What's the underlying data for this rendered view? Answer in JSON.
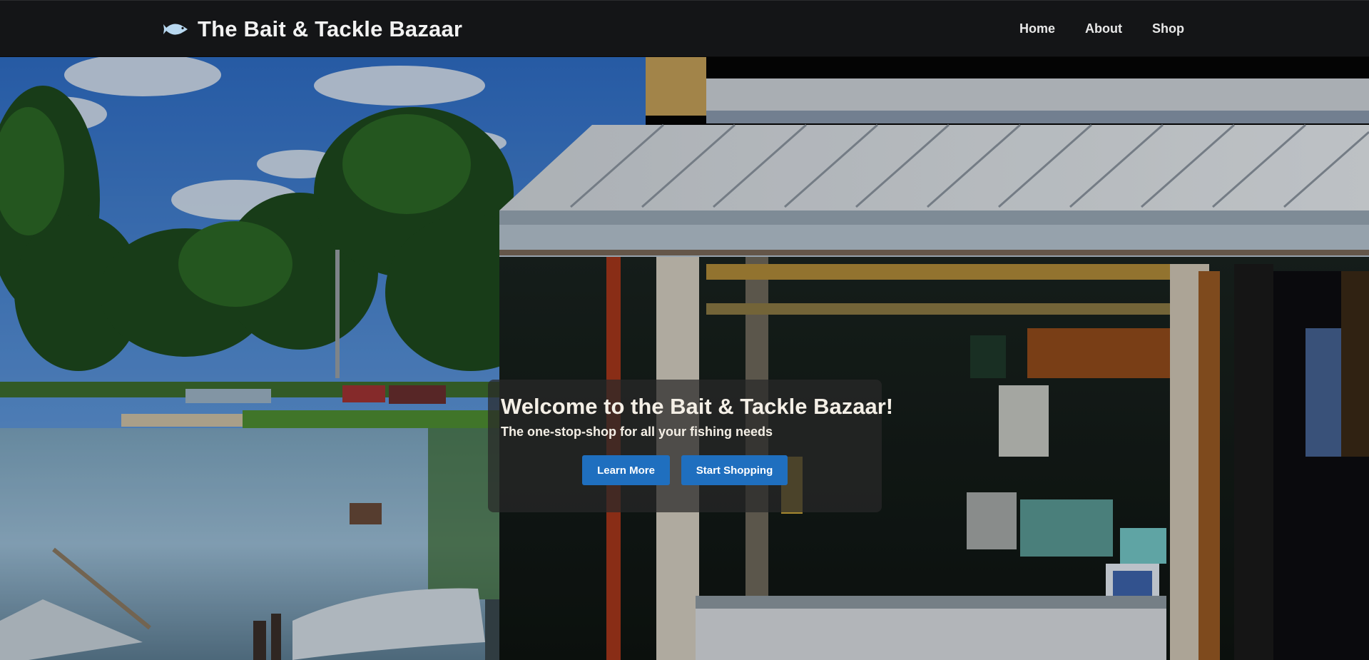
{
  "navbar": {
    "brand_name": "The Bait & Tackle Bazaar",
    "brand_icon": "fish-icon",
    "links": [
      {
        "label": "Home"
      },
      {
        "label": "About"
      },
      {
        "label": "Shop"
      }
    ]
  },
  "hero": {
    "title": "Welcome to the Bait & Tackle Bazaar!",
    "subtitle": "The one-stop-shop for all your fishing needs",
    "buttons": {
      "learn_more": "Learn More",
      "start_shopping": "Start Shopping"
    },
    "background_image": "bait-shop-lakeside-photo"
  },
  "colors": {
    "navbar_bg": "#141517",
    "button_bg": "#1f6fbf",
    "card_bg": "rgba(40,40,40,0.72)",
    "text_light": "#f4efe6"
  }
}
